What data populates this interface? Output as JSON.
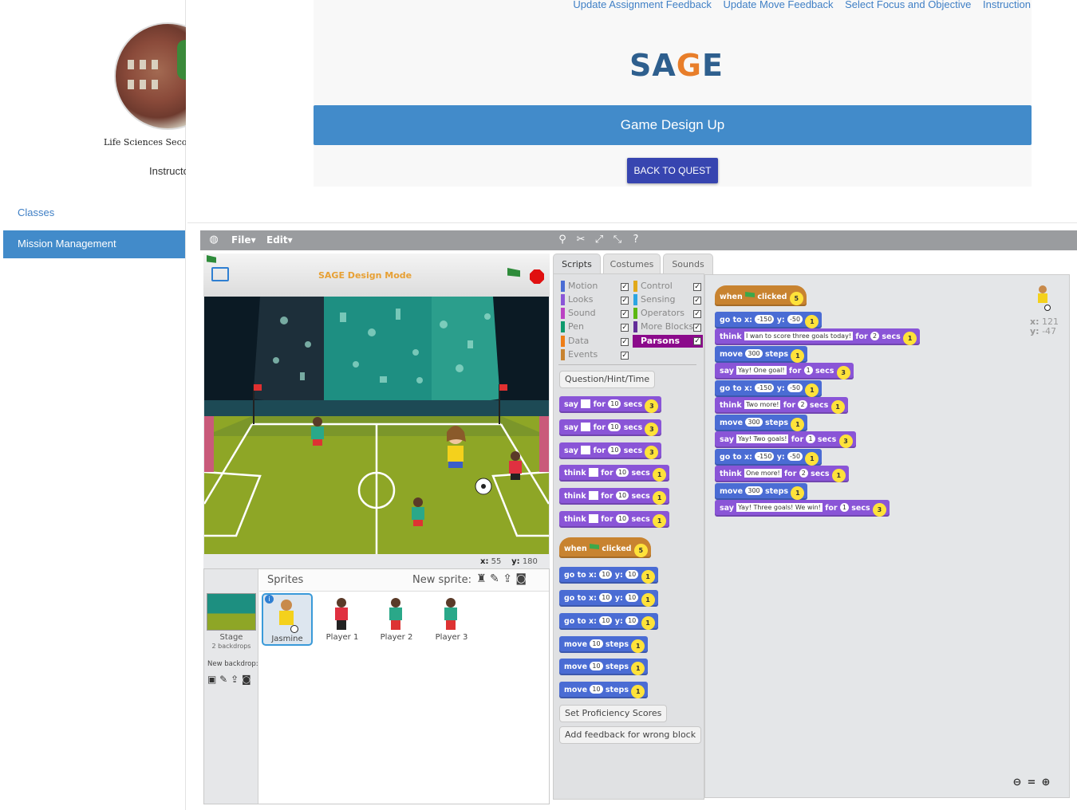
{
  "sidebar": {
    "school": "Life Sciences Secondary School",
    "instructor": "Instructor",
    "nav": [
      "Classes",
      "Mission Management"
    ]
  },
  "header": {
    "links": [
      "Update Assignment Feedback",
      "Update Move Feedback",
      "Select Focus and Objective",
      "Instruction"
    ],
    "logo": "SAGE",
    "quest_title": "Game Design Up",
    "back_button": "BACK TO QUEST"
  },
  "scratch": {
    "menu": {
      "file": "File",
      "edit": "Edit"
    },
    "mode_label": "SAGE Design Mode",
    "coords": {
      "x_label": "x:",
      "x": "55",
      "y_label": "y:",
      "y": "180"
    },
    "sprites": {
      "title": "Sprites",
      "new_sprite_label": "New sprite:",
      "stage_label": "Stage",
      "stage_sub": "2 backdrops",
      "new_backdrop": "New backdrop:",
      "items": [
        "Jasmine",
        "Player 1",
        "Player 2",
        "Player 3"
      ]
    },
    "tabs": [
      "Scripts",
      "Costumes",
      "Sounds"
    ],
    "categories": [
      {
        "name": "Motion",
        "color": "#4a6cd4"
      },
      {
        "name": "Looks",
        "color": "#8a55d7"
      },
      {
        "name": "Sound",
        "color": "#bb42c3"
      },
      {
        "name": "Pen",
        "color": "#0e9a6c"
      },
      {
        "name": "Data",
        "color": "#ee7d16"
      },
      {
        "name": "Events",
        "color": "#c88330"
      },
      {
        "name": "Control",
        "color": "#e1a91a"
      },
      {
        "name": "Sensing",
        "color": "#2ca5e2"
      },
      {
        "name": "Operators",
        "color": "#5cb712"
      },
      {
        "name": "More Blocks",
        "color": "#632d99"
      },
      {
        "name": "Parsons",
        "color": "#8b0a8b"
      }
    ],
    "palette_buttons": {
      "question": "Question/Hint/Time",
      "proficiency": "Set Proficiency Scores",
      "feedback": "Add feedback for wrong block"
    },
    "kw": {
      "say": "say",
      "think": "think",
      "for": "for",
      "secs": "secs",
      "when": "when",
      "clicked": "clicked",
      "go_to": "go to",
      "x": "x:",
      "y": "y:",
      "move": "move",
      "steps": "steps"
    },
    "palette_vals": {
      "secs": "10",
      "n": "10",
      "star3": "3",
      "star1": "1",
      "star5": "5"
    },
    "script": {
      "hat_star": "5",
      "goto_x": "-150",
      "goto_y": "-50",
      "think1": "I wan to score three goals today!",
      "think1_secs": "2",
      "move_steps": "300",
      "say1": "Yay! One goal!",
      "say1_secs": "1",
      "think2": "Two more!",
      "think2_secs": "2",
      "say2": "Yay! Two goals!",
      "say2_secs": "1",
      "think3": "One more!",
      "think3_secs": "2",
      "say3": "Yay! Three goals! We win!",
      "say3_secs": "1",
      "star1": "1",
      "star3": "3"
    },
    "sprite_info": {
      "x_label": "x:",
      "x": "121",
      "y_label": "y:",
      "y": "-47"
    }
  }
}
